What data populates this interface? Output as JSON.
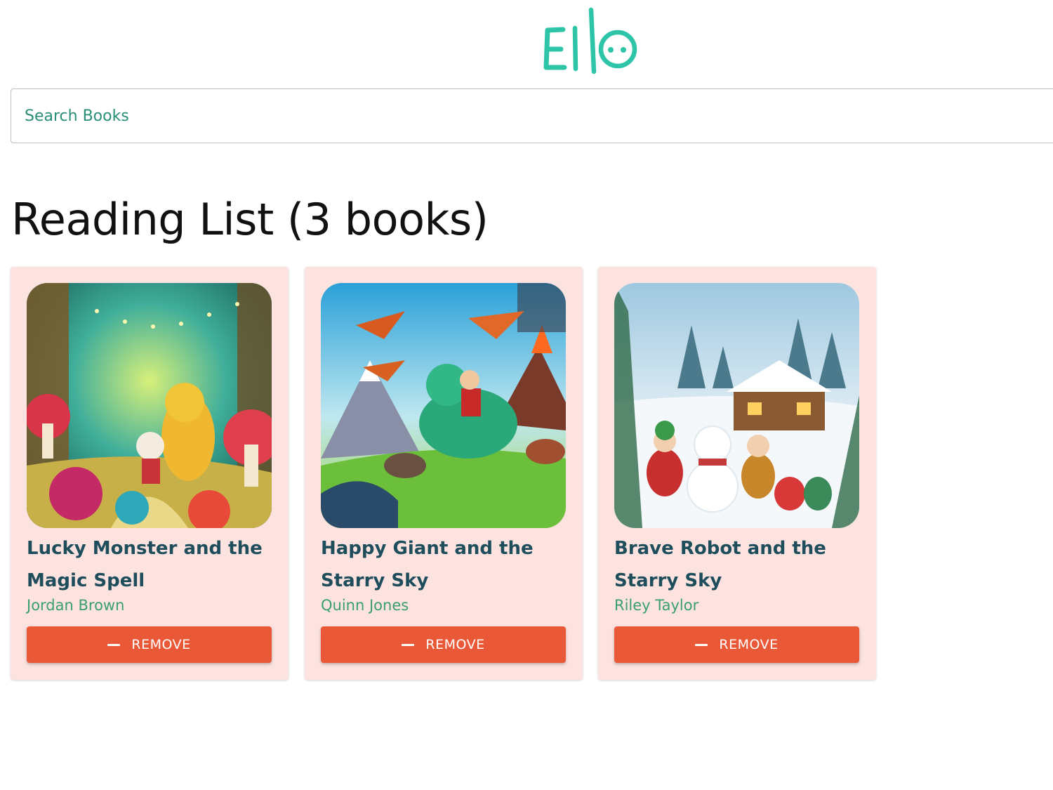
{
  "header": {
    "logo_text": "Ello",
    "brand_color": "#2ec4a8"
  },
  "search": {
    "placeholder": "Search Books",
    "value": ""
  },
  "main": {
    "title": "Reading List (3 books)"
  },
  "books": [
    {
      "title": "Lucky Monster and the Magic Spell",
      "author": "Jordan Brown",
      "remove_label": "REMOVE",
      "cover_scene": "enchanted forest with mushrooms and a dragon"
    },
    {
      "title": "Happy Giant and the Starry Sky",
      "author": "Quinn Jones",
      "remove_label": "REMOVE",
      "cover_scene": "boy riding a dinosaur with pterodactyls and volcano"
    },
    {
      "title": "Brave Robot and the Starry Sky",
      "author": "Riley Taylor",
      "remove_label": "REMOVE",
      "cover_scene": "children building a snowman near a snowy cabin"
    }
  ],
  "colors": {
    "card_background": "#fde3e0",
    "title_color": "#1e4d5c",
    "author_color": "#3a9e72",
    "remove_button": "#ea5937"
  }
}
